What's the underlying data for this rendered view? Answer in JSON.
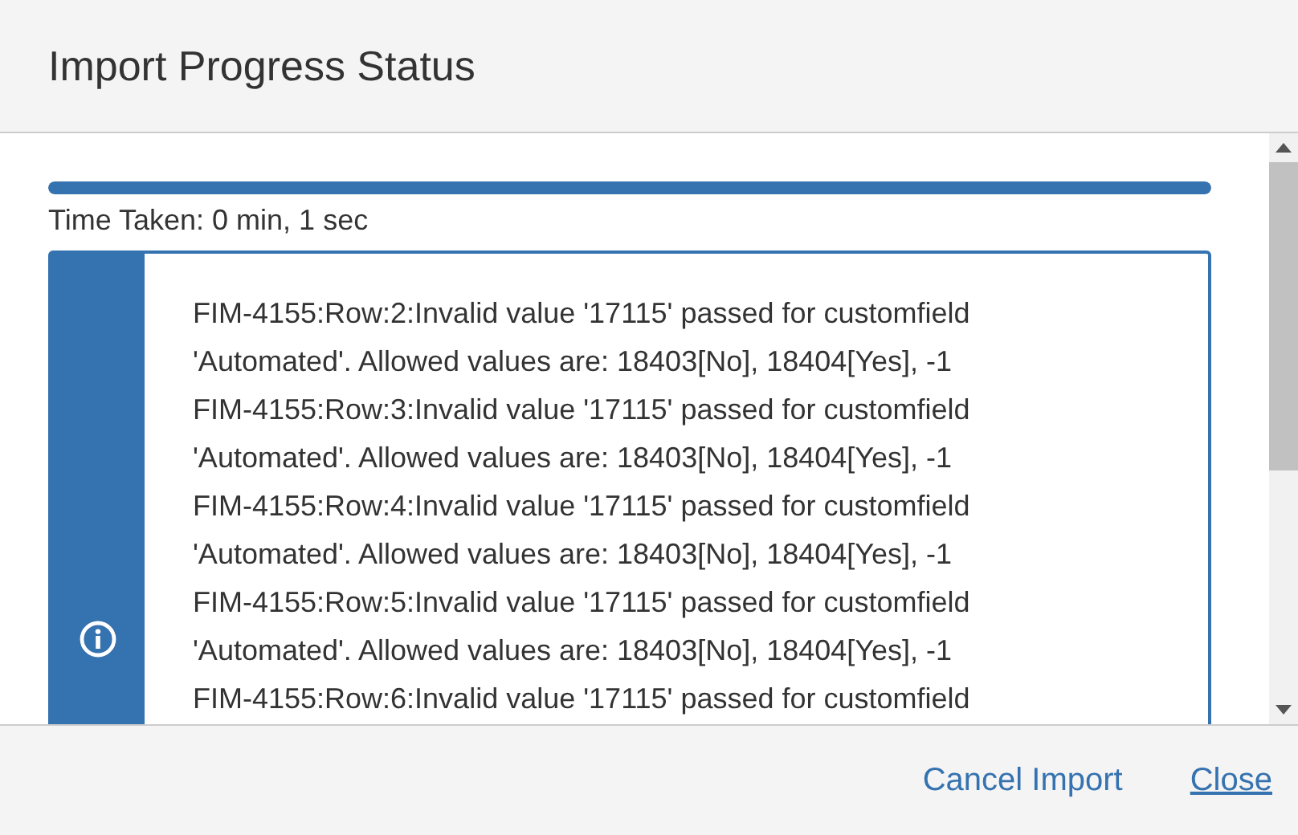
{
  "dialog": {
    "title": "Import Progress Status"
  },
  "progress": {
    "level": 1,
    "time_taken": "Time Taken: 0 min, 1 sec"
  },
  "messages": [
    "FIM-4155:Row:2:Invalid value '17115' passed for customfield 'Automated'. Allowed values are: 18403[No], 18404[Yes], -1",
    "FIM-4155:Row:3:Invalid value '17115' passed for customfield 'Automated'. Allowed values are: 18403[No], 18404[Yes], -1",
    "FIM-4155:Row:4:Invalid value '17115' passed for customfield 'Automated'. Allowed values are: 18403[No], 18404[Yes], -1",
    "FIM-4155:Row:5:Invalid value '17115' passed for customfield 'Automated'. Allowed values are: 18403[No], 18404[Yes], -1",
    "FIM-4155:Row:6:Invalid value '17115' passed for customfield"
  ],
  "footer": {
    "links": [
      {
        "label": "Cancel Import",
        "underlined": false
      },
      {
        "label": "Close",
        "underlined": true
      }
    ]
  }
}
